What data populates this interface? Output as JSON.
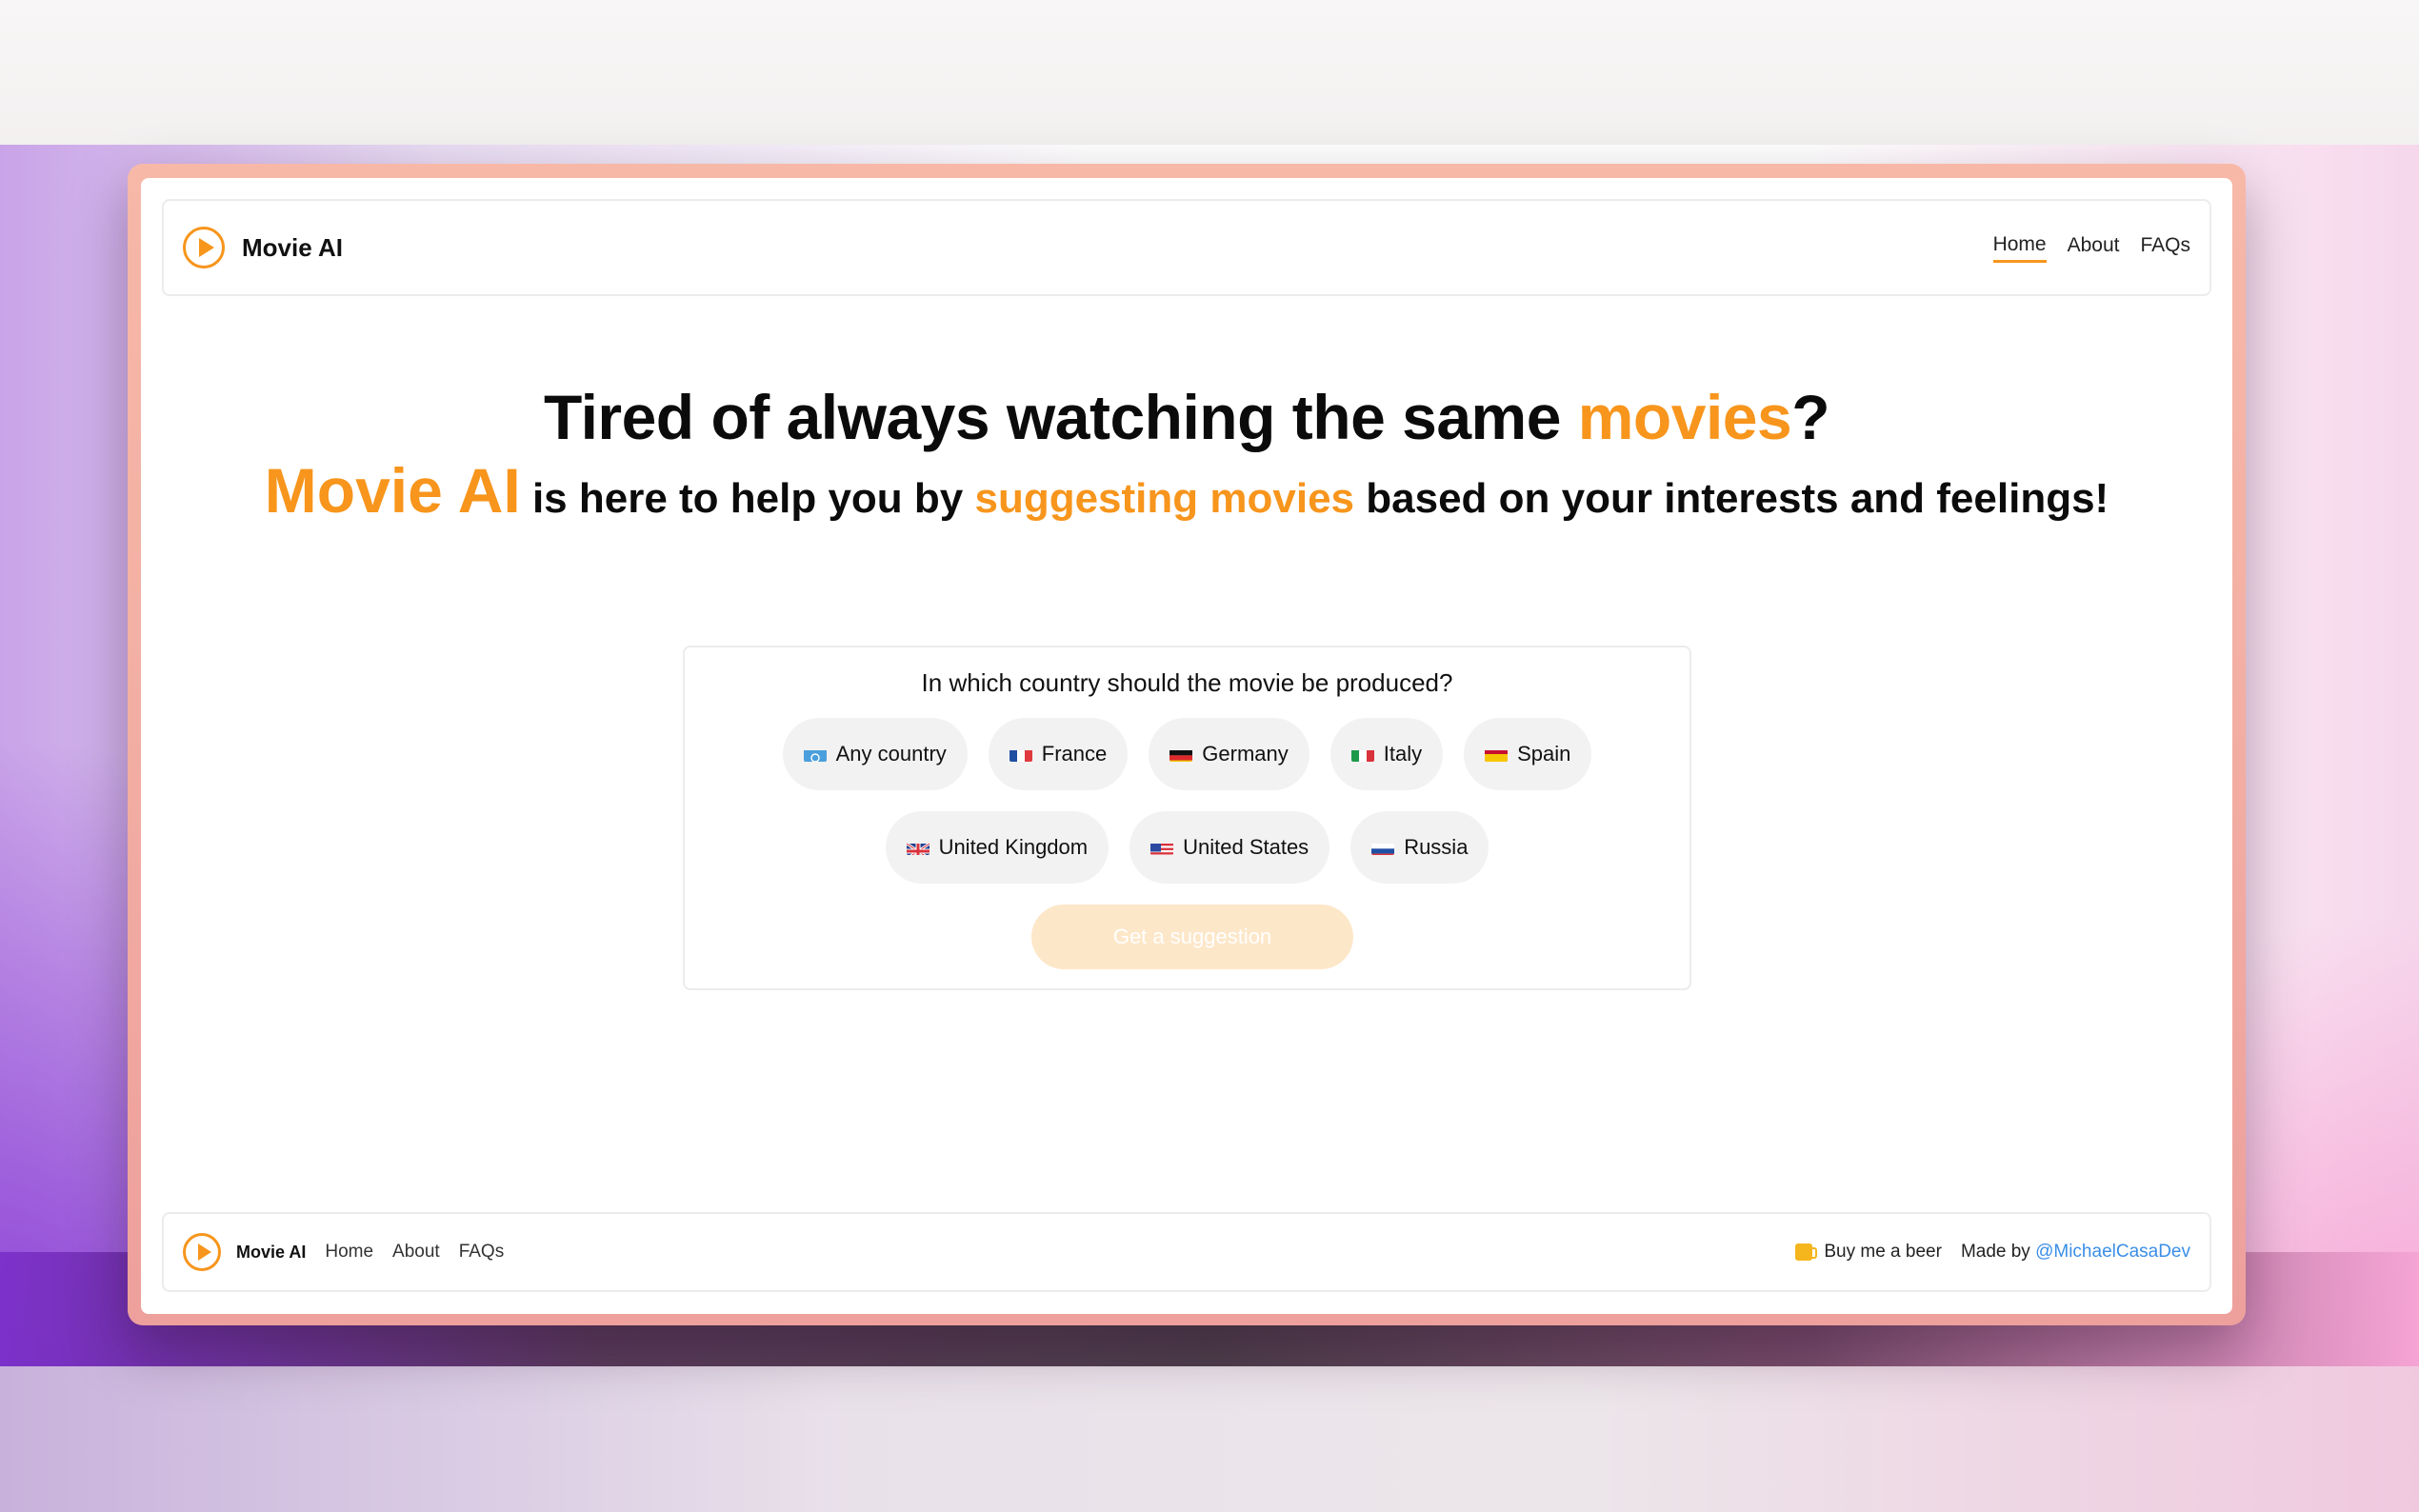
{
  "app": {
    "brand": "Movie AI"
  },
  "header": {
    "nav": [
      {
        "label": "Home",
        "active": true
      },
      {
        "label": "About",
        "active": false
      },
      {
        "label": "FAQs",
        "active": false
      }
    ]
  },
  "hero": {
    "line1_a": "Tired of always watching the same ",
    "line1_b": "movies",
    "line1_c": "?",
    "line2_brand": "Movie AI",
    "line2_a": " is here to help you by ",
    "line2_b": "suggesting movies",
    "line2_c": " based on your interests and feelings!"
  },
  "form": {
    "question": "In which country should the movie be produced?",
    "countries_row1": [
      {
        "label": "Any country",
        "flag": "un-flag"
      },
      {
        "label": "France",
        "flag": "france-flag"
      },
      {
        "label": "Germany",
        "flag": "germany-flag"
      },
      {
        "label": "Italy",
        "flag": "italy-flag"
      },
      {
        "label": "Spain",
        "flag": "spain-flag"
      }
    ],
    "countries_row2": [
      {
        "label": "United Kingdom",
        "flag": "uk-flag"
      },
      {
        "label": "United States",
        "flag": "us-flag"
      },
      {
        "label": "Russia",
        "flag": "russia-flag"
      }
    ],
    "submit_label": "Get a suggestion"
  },
  "footer": {
    "brand": "Movie AI",
    "links": [
      "Home",
      "About",
      "FAQs"
    ],
    "beer": "Buy me a beer",
    "made_by": "Made by ",
    "author": "@MichaelCasaDev"
  },
  "colors": {
    "accent": "#f7951c",
    "link": "#3a8ee6",
    "chip_bg": "#f2f2f2",
    "cta_disabled": "#fde7c9"
  }
}
